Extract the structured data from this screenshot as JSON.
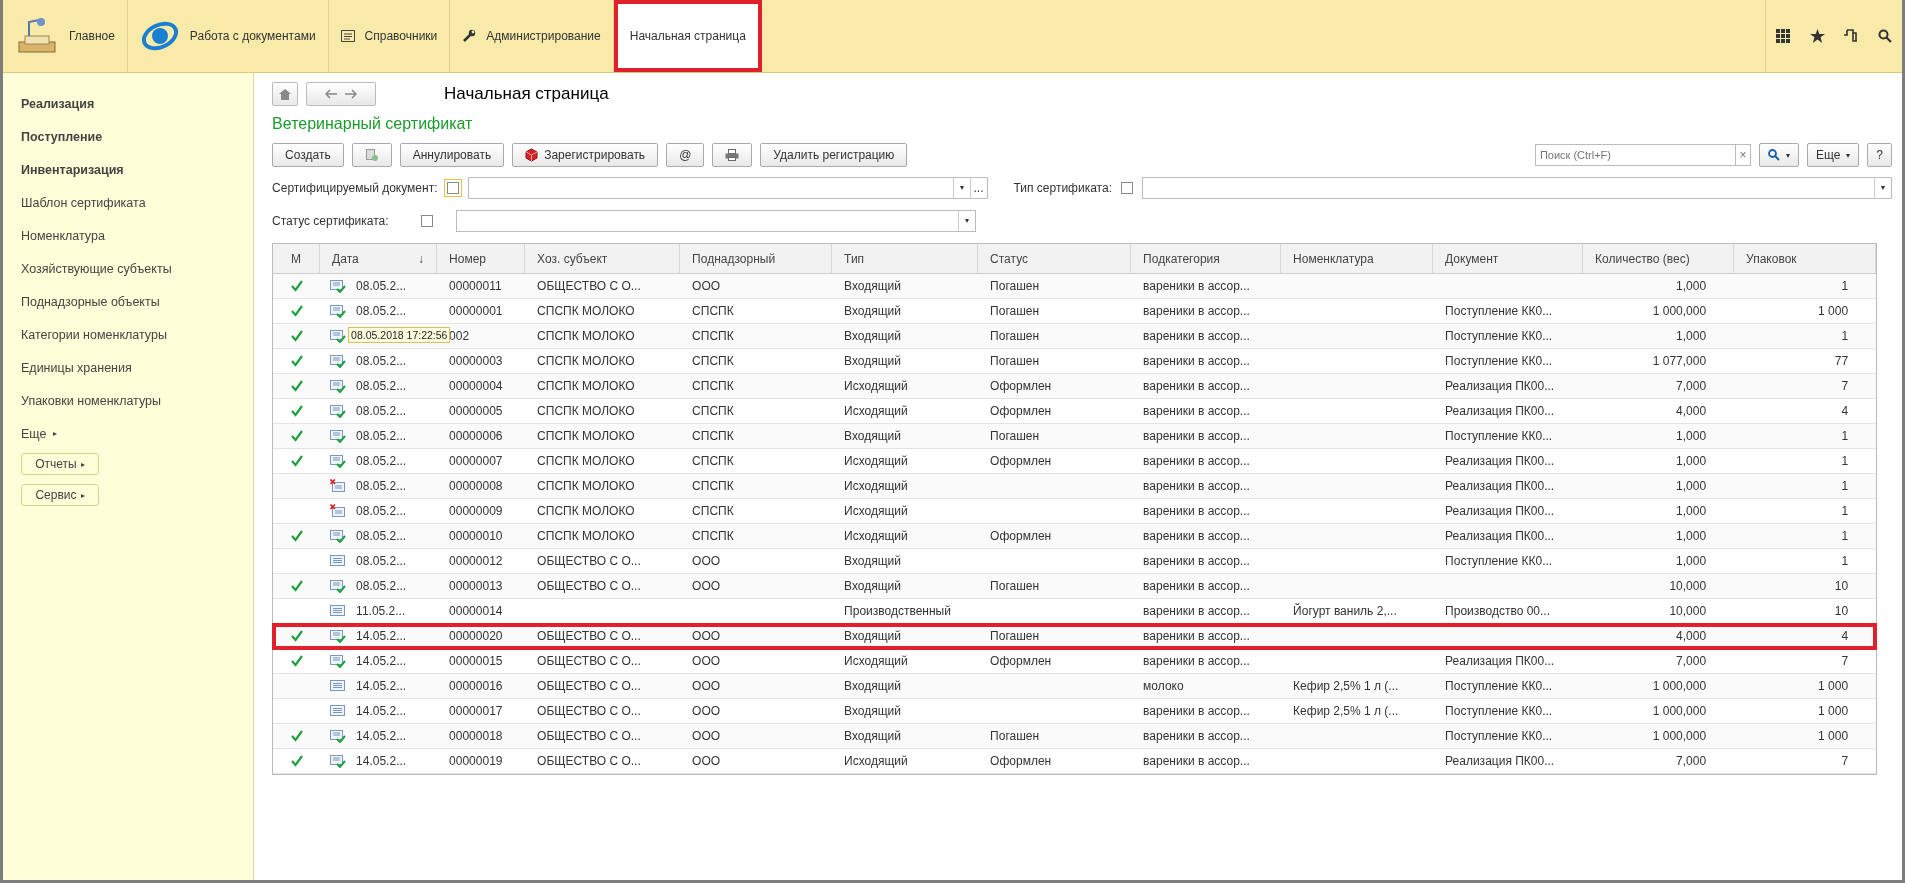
{
  "top_menu": [
    {
      "label": "Главное",
      "kind": "desk",
      "selected": false,
      "outlined": false
    },
    {
      "label": "Работа с документами",
      "kind": "logo",
      "selected": false,
      "outlined": false
    },
    {
      "label": "Справочники",
      "kind": "list",
      "selected": false,
      "outlined": false
    },
    {
      "label": "Администрирование",
      "kind": "wrench",
      "selected": false,
      "outlined": false
    },
    {
      "label": "Начальная страница",
      "kind": "plain",
      "selected": true,
      "outlined": true
    }
  ],
  "sidebar": {
    "items": [
      {
        "label": "Реализация",
        "kind": "section"
      },
      {
        "label": "Поступление",
        "kind": "section"
      },
      {
        "label": "Инвентаризация",
        "kind": "section"
      },
      {
        "label": "Шаблон сертификата",
        "kind": "link"
      },
      {
        "label": "Номенклатура",
        "kind": "link"
      },
      {
        "label": "Хозяйствующие субъекты",
        "kind": "link"
      },
      {
        "label": "Поднадзорные объекты",
        "kind": "link"
      },
      {
        "label": "Категории номенклатуры",
        "kind": "link"
      },
      {
        "label": "Единицы хранения",
        "kind": "link"
      },
      {
        "label": "Упаковки номенклатуры",
        "kind": "link"
      },
      {
        "label": "Еще",
        "kind": "more",
        "caret": "▸"
      },
      {
        "label": "Отчеты",
        "kind": "button",
        "caret": "▸"
      },
      {
        "label": "Сервис",
        "kind": "button",
        "caret": "▸"
      }
    ]
  },
  "page_title": "Начальная страница",
  "form_title": "Ветеринарный сертификат",
  "toolbar": [
    {
      "kind": "text",
      "label": "Создать"
    },
    {
      "kind": "copy"
    },
    {
      "kind": "text",
      "label": "Аннулировать"
    },
    {
      "kind": "register",
      "label": "Зарегистрировать"
    },
    {
      "kind": "text",
      "label": "@"
    },
    {
      "kind": "print"
    },
    {
      "kind": "text",
      "label": "Удалить регистрацию"
    }
  ],
  "search": {
    "placeholder": "Поиск (Ctrl+F)",
    "clear": "×",
    "caret": "▾"
  },
  "more_button": {
    "label": "Еще",
    "caret": "▾"
  },
  "help_button": "?",
  "filters": [
    {
      "label": "Сертифицируемый документ:",
      "checked": false,
      "focused": true,
      "dropdown": "▾",
      "select": "..."
    },
    {
      "label": "Тип сертификата:",
      "checked": false,
      "focused": false,
      "dropdown": "▾"
    },
    {
      "label": "Статус сертификата:",
      "checked": false,
      "focused": false,
      "dropdown": "▾"
    }
  ],
  "table": {
    "columns": [
      {
        "label": "М",
        "kind": "mark"
      },
      {
        "label": "Дата",
        "sort": "↓",
        "kind": "date"
      },
      {
        "label": "Номер",
        "kind": "text"
      },
      {
        "label": "Хоз. субъект",
        "kind": "text"
      },
      {
        "label": "Поднадзорный",
        "kind": "text"
      },
      {
        "label": "Тип",
        "kind": "text"
      },
      {
        "label": "Статус",
        "kind": "text"
      },
      {
        "label": "Подкатегория",
        "kind": "text"
      },
      {
        "label": "Номенклатура",
        "kind": "text"
      },
      {
        "label": "Документ",
        "kind": "text"
      },
      {
        "label": "Количество (вес)",
        "kind": "number"
      },
      {
        "label": "Упаковок",
        "kind": "number"
      }
    ],
    "rows": [
      {
        "marked": true,
        "kind": "posted",
        "date": "08.05.2...",
        "number": "00000011",
        "entity": "ОБЩЕСТВО С О...",
        "supervised": "ООО",
        "type": "Входящий",
        "status": "Погашен",
        "subcategory": "вареники в ассор...",
        "quantity": "1,000",
        "packs": "1",
        "outlined": false
      },
      {
        "marked": true,
        "kind": "posted",
        "date": "08.05.2...",
        "number": "00000001",
        "entity": "СПСПК  МОЛОКО",
        "supervised": "СПСПК",
        "type": "Входящий",
        "status": "Погашен",
        "subcategory": "вареники в ассор...",
        "document": "Поступление КК0...",
        "quantity": "1 000,000",
        "packs": "1 000",
        "outlined": false
      },
      {
        "marked": true,
        "kind": "posted",
        "tooltip": "08.05.2018 17:22:56",
        "number": "002",
        "entity": "СПСПК  МОЛОКО",
        "supervised": "СПСПК",
        "type": "Входящий",
        "status": "Погашен",
        "subcategory": "вареники в ассор...",
        "document": "Поступление КК0...",
        "quantity": "1,000",
        "packs": "1",
        "outlined": false
      },
      {
        "marked": true,
        "kind": "posted",
        "date": "08.05.2...",
        "number": "00000003",
        "entity": "СПСПК  МОЛОКО",
        "supervised": "СПСПК",
        "type": "Входящий",
        "status": "Погашен",
        "subcategory": "вареники в ассор...",
        "document": "Поступление КК0...",
        "quantity": "1 077,000",
        "packs": "77",
        "outlined": false
      },
      {
        "marked": true,
        "kind": "posted",
        "date": "08.05.2...",
        "number": "00000004",
        "entity": "СПСПК  МОЛОКО",
        "supervised": "СПСПК",
        "type": "Исходящий",
        "status": "Оформлен",
        "subcategory": "вареники в ассор...",
        "document": "Реализация ПК00...",
        "quantity": "7,000",
        "packs": "7",
        "outlined": false
      },
      {
        "marked": true,
        "kind": "posted",
        "date": "08.05.2...",
        "number": "00000005",
        "entity": "СПСПК  МОЛОКО",
        "supervised": "СПСПК",
        "type": "Исходящий",
        "status": "Оформлен",
        "subcategory": "вареники в ассор...",
        "document": "Реализация ПК00...",
        "quantity": "4,000",
        "packs": "4",
        "outlined": false
      },
      {
        "marked": true,
        "kind": "posted",
        "date": "08.05.2...",
        "number": "00000006",
        "entity": "СПСПК  МОЛОКО",
        "supervised": "СПСПК",
        "type": "Входящий",
        "status": "Погашен",
        "subcategory": "вареники в ассор...",
        "document": "Поступление КК0...",
        "quantity": "1,000",
        "packs": "1",
        "outlined": false
      },
      {
        "marked": true,
        "kind": "posted",
        "date": "08.05.2...",
        "number": "00000007",
        "entity": "СПСПК  МОЛОКО",
        "supervised": "СПСПК",
        "type": "Исходящий",
        "status": "Оформлен",
        "subcategory": "вареники в ассор...",
        "document": "Реализация ПК00...",
        "quantity": "1,000",
        "packs": "1",
        "outlined": false
      },
      {
        "marked": false,
        "kind": "deleted",
        "date": "08.05.2...",
        "number": "00000008",
        "entity": "СПСПК  МОЛОКО",
        "supervised": "СПСПК",
        "type": "Исходящий",
        "subcategory": "вареники в ассор...",
        "document": "Реализация ПК00...",
        "quantity": "1,000",
        "packs": "1",
        "outlined": false
      },
      {
        "marked": false,
        "kind": "deleted",
        "date": "08.05.2...",
        "number": "00000009",
        "entity": "СПСПК  МОЛОКО",
        "supervised": "СПСПК",
        "type": "Исходящий",
        "subcategory": "вареники в ассор...",
        "document": "Реализация ПК00...",
        "quantity": "1,000",
        "packs": "1",
        "outlined": false
      },
      {
        "marked": true,
        "kind": "posted",
        "date": "08.05.2...",
        "number": "00000010",
        "entity": "СПСПК  МОЛОКО",
        "supervised": "СПСПК",
        "type": "Исходящий",
        "status": "Оформлен",
        "subcategory": "вареники в ассор...",
        "document": "Реализация ПК00...",
        "quantity": "1,000",
        "packs": "1",
        "outlined": false
      },
      {
        "marked": false,
        "kind": "plain",
        "date": "08.05.2...",
        "number": "00000012",
        "entity": "ОБЩЕСТВО С О...",
        "supervised": "ООО",
        "type": "Входящий",
        "subcategory": "вареники в ассор...",
        "document": "Поступление КК0...",
        "quantity": "1,000",
        "packs": "1",
        "outlined": false
      },
      {
        "marked": true,
        "kind": "posted",
        "date": "08.05.2...",
        "number": "00000013",
        "entity": "ОБЩЕСТВО С О...",
        "supervised": "ООО",
        "type": "Входящий",
        "status": "Погашен",
        "subcategory": "вареники в ассор...",
        "quantity": "10,000",
        "packs": "10",
        "outlined": false
      },
      {
        "marked": false,
        "kind": "plain",
        "date": "11.05.2...",
        "number": "00000014",
        "type": "Производственный",
        "subcategory": "вареники в ассор...",
        "nomenclature": "Йогурт ваниль 2,...",
        "document": "Производство 00...",
        "quantity": "10,000",
        "packs": "10",
        "outlined": false
      },
      {
        "marked": true,
        "kind": "posted",
        "date": "14.05.2...",
        "number": "00000020",
        "entity": "ОБЩЕСТВО С О...",
        "supervised": "ООО",
        "type": "Входящий",
        "status": "Погашен",
        "subcategory": "вареники в ассор...",
        "quantity": "4,000",
        "packs": "4",
        "outlined": true
      },
      {
        "marked": true,
        "kind": "posted",
        "date": "14.05.2...",
        "number": "00000015",
        "entity": "ОБЩЕСТВО С О...",
        "supervised": "ООО",
        "type": "Исходящий",
        "status": "Оформлен",
        "subcategory": "вареники в ассор...",
        "document": "Реализация ПК00...",
        "quantity": "7,000",
        "packs": "7",
        "outlined": false
      },
      {
        "marked": false,
        "kind": "plain",
        "date": "14.05.2...",
        "number": "00000016",
        "entity": "ОБЩЕСТВО С О...",
        "supervised": "ООО",
        "type": "Входящий",
        "subcategory": "молоко",
        "nomenclature": "Кефир 2,5%  1 л (...",
        "document": "Поступление КК0...",
        "quantity": "1 000,000",
        "packs": "1 000",
        "outlined": false
      },
      {
        "marked": false,
        "kind": "plain",
        "date": "14.05.2...",
        "number": "00000017",
        "entity": "ОБЩЕСТВО С О...",
        "supervised": "ООО",
        "type": "Входящий",
        "subcategory": "вареники в ассор...",
        "nomenclature": "Кефир 2,5%  1 л (...",
        "document": "Поступление КК0...",
        "quantity": "1 000,000",
        "packs": "1 000",
        "outlined": false
      },
      {
        "marked": true,
        "kind": "posted",
        "date": "14.05.2...",
        "number": "00000018",
        "entity": "ОБЩЕСТВО С О...",
        "supervised": "ООО",
        "type": "Входящий",
        "status": "Погашен",
        "subcategory": "вареники в ассор...",
        "document": "Поступление КК0...",
        "quantity": "1 000,000",
        "packs": "1 000",
        "outlined": false
      },
      {
        "marked": true,
        "kind": "posted",
        "date": "14.05.2...",
        "number": "00000019",
        "entity": "ОБЩЕСТВО С О...",
        "supervised": "ООО",
        "type": "Исходящий",
        "status": "Оформлен",
        "subcategory": "вареники в ассор...",
        "document": "Реализация ПК00...",
        "quantity": "7,000",
        "packs": "7",
        "outlined": false
      }
    ]
  }
}
